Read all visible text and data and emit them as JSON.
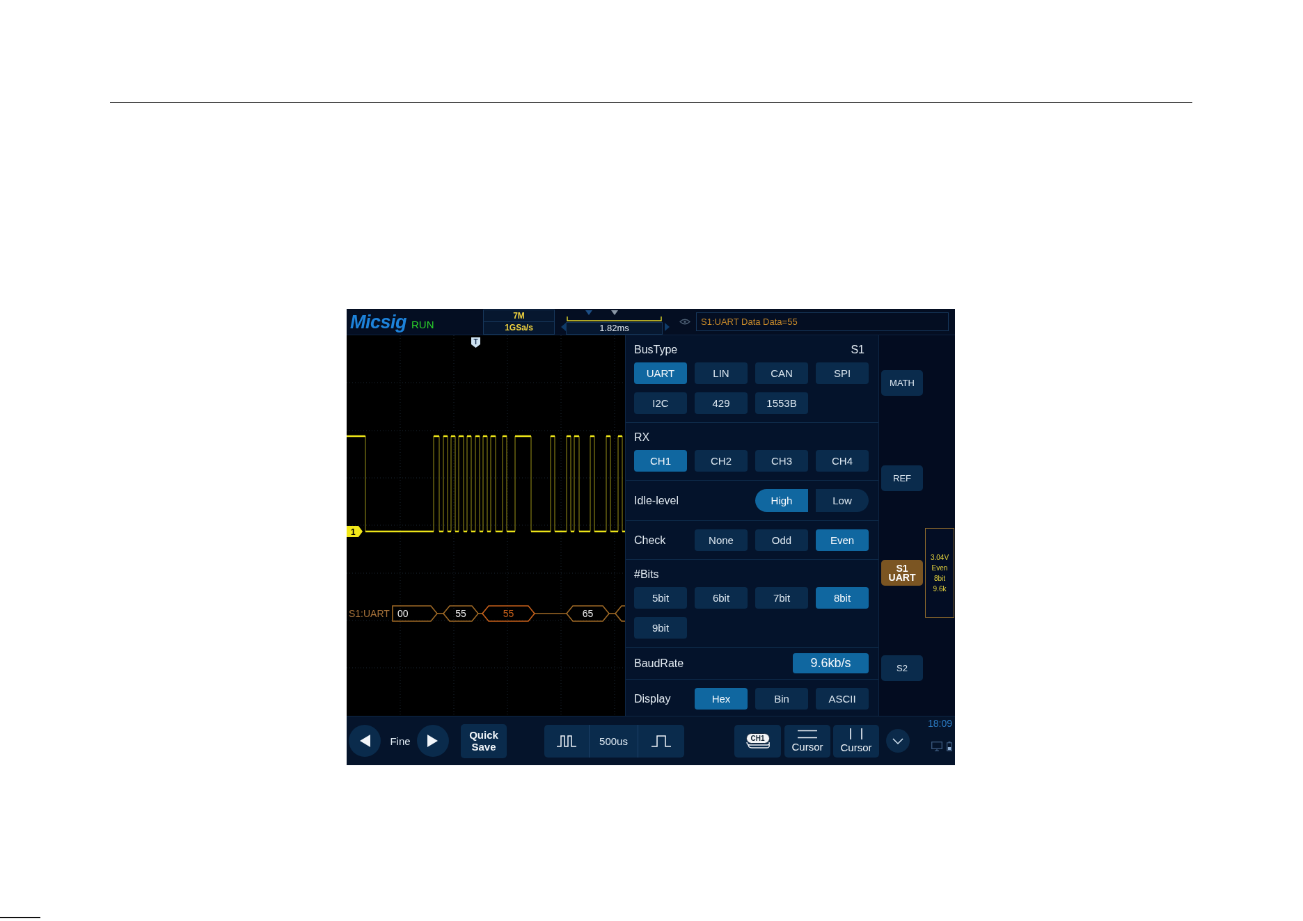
{
  "header": {
    "logo": "Micsig",
    "status": "RUN",
    "memory_depth": "7M",
    "sample_rate": "1GSa/s",
    "time_offset": "1.82ms",
    "message": "S1:UART Data Data=55"
  },
  "waveform": {
    "trigger_marker": "T",
    "channel_marker": "1",
    "bus_label": "S1:UART",
    "frames": [
      {
        "value": "00",
        "highlighted": false
      },
      {
        "value": "55",
        "highlighted": false
      },
      {
        "value": "55",
        "highlighted": true
      },
      {
        "value": "65",
        "highlighted": false
      }
    ]
  },
  "settings": {
    "sections": [
      {
        "label": "BusType",
        "kind": "grid",
        "badge": "S1",
        "options": [
          {
            "label": "UART",
            "selected": true
          },
          {
            "label": "LIN",
            "selected": false
          },
          {
            "label": "CAN",
            "selected": false
          },
          {
            "label": "SPI",
            "selected": false
          },
          {
            "label": "I2C",
            "selected": false
          },
          {
            "label": "429",
            "selected": false
          },
          {
            "label": "1553B",
            "selected": false
          }
        ]
      },
      {
        "label": "RX",
        "kind": "grid",
        "options": [
          {
            "label": "CH1",
            "selected": true
          },
          {
            "label": "CH2",
            "selected": false
          },
          {
            "label": "CH3",
            "selected": false
          },
          {
            "label": "CH4",
            "selected": false
          }
        ]
      },
      {
        "label": "Idle-level",
        "kind": "toggle",
        "options": [
          {
            "label": "High",
            "selected": true
          },
          {
            "label": "Low",
            "selected": false
          }
        ]
      },
      {
        "label": "Check",
        "kind": "inline",
        "options": [
          {
            "label": "None",
            "selected": false
          },
          {
            "label": "Odd",
            "selected": false
          },
          {
            "label": "Even",
            "selected": true
          }
        ]
      },
      {
        "label": "#Bits",
        "kind": "grid",
        "options": [
          {
            "label": "5bit",
            "selected": false
          },
          {
            "label": "6bit",
            "selected": false
          },
          {
            "label": "7bit",
            "selected": false
          },
          {
            "label": "8bit",
            "selected": true
          },
          {
            "label": "9bit",
            "selected": false
          }
        ]
      },
      {
        "label": "BaudRate",
        "kind": "field",
        "value": "9.6kb/s"
      },
      {
        "label": "Display",
        "kind": "inline",
        "options": [
          {
            "label": "Hex",
            "selected": true
          },
          {
            "label": "Bin",
            "selected": false
          },
          {
            "label": "ASCII",
            "selected": false
          }
        ]
      }
    ]
  },
  "side_buttons": [
    {
      "label": "MATH",
      "selected": false
    },
    {
      "label": "REF",
      "selected": false
    },
    {
      "label": "S1 UART",
      "selected": true,
      "summary": [
        "3.04V",
        "Even",
        "8bit",
        "9.6k"
      ]
    },
    {
      "label": "S2",
      "selected": false
    }
  ],
  "bottom_bar": {
    "step_label": "Fine",
    "quick_save": "Quick Save",
    "timebase": "500us",
    "channel": "CH1",
    "cursor_buttons": [
      "Cursor",
      "Cursor"
    ],
    "clock": "18:09"
  }
}
